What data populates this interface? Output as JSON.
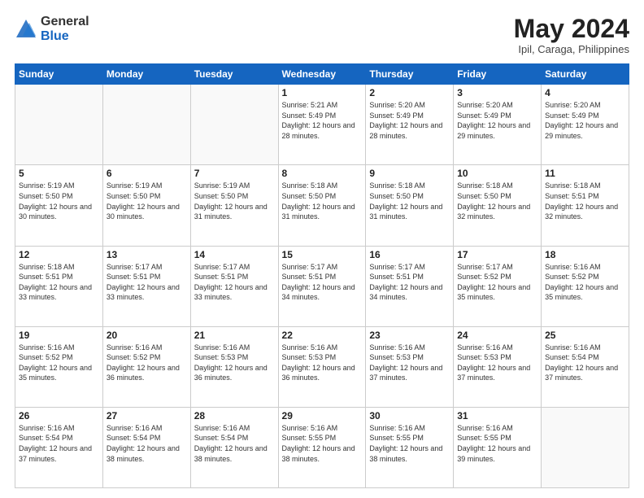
{
  "header": {
    "logo_general": "General",
    "logo_blue": "Blue",
    "month": "May 2024",
    "location": "Ipil, Caraga, Philippines"
  },
  "days_of_week": [
    "Sunday",
    "Monday",
    "Tuesday",
    "Wednesday",
    "Thursday",
    "Friday",
    "Saturday"
  ],
  "weeks": [
    [
      {
        "day": "",
        "sunrise": "",
        "sunset": "",
        "daylight": ""
      },
      {
        "day": "",
        "sunrise": "",
        "sunset": "",
        "daylight": ""
      },
      {
        "day": "",
        "sunrise": "",
        "sunset": "",
        "daylight": ""
      },
      {
        "day": "1",
        "sunrise": "Sunrise: 5:21 AM",
        "sunset": "Sunset: 5:49 PM",
        "daylight": "Daylight: 12 hours and 28 minutes."
      },
      {
        "day": "2",
        "sunrise": "Sunrise: 5:20 AM",
        "sunset": "Sunset: 5:49 PM",
        "daylight": "Daylight: 12 hours and 28 minutes."
      },
      {
        "day": "3",
        "sunrise": "Sunrise: 5:20 AM",
        "sunset": "Sunset: 5:49 PM",
        "daylight": "Daylight: 12 hours and 29 minutes."
      },
      {
        "day": "4",
        "sunrise": "Sunrise: 5:20 AM",
        "sunset": "Sunset: 5:49 PM",
        "daylight": "Daylight: 12 hours and 29 minutes."
      }
    ],
    [
      {
        "day": "5",
        "sunrise": "Sunrise: 5:19 AM",
        "sunset": "Sunset: 5:50 PM",
        "daylight": "Daylight: 12 hours and 30 minutes."
      },
      {
        "day": "6",
        "sunrise": "Sunrise: 5:19 AM",
        "sunset": "Sunset: 5:50 PM",
        "daylight": "Daylight: 12 hours and 30 minutes."
      },
      {
        "day": "7",
        "sunrise": "Sunrise: 5:19 AM",
        "sunset": "Sunset: 5:50 PM",
        "daylight": "Daylight: 12 hours and 31 minutes."
      },
      {
        "day": "8",
        "sunrise": "Sunrise: 5:18 AM",
        "sunset": "Sunset: 5:50 PM",
        "daylight": "Daylight: 12 hours and 31 minutes."
      },
      {
        "day": "9",
        "sunrise": "Sunrise: 5:18 AM",
        "sunset": "Sunset: 5:50 PM",
        "daylight": "Daylight: 12 hours and 31 minutes."
      },
      {
        "day": "10",
        "sunrise": "Sunrise: 5:18 AM",
        "sunset": "Sunset: 5:50 PM",
        "daylight": "Daylight: 12 hours and 32 minutes."
      },
      {
        "day": "11",
        "sunrise": "Sunrise: 5:18 AM",
        "sunset": "Sunset: 5:51 PM",
        "daylight": "Daylight: 12 hours and 32 minutes."
      }
    ],
    [
      {
        "day": "12",
        "sunrise": "Sunrise: 5:18 AM",
        "sunset": "Sunset: 5:51 PM",
        "daylight": "Daylight: 12 hours and 33 minutes."
      },
      {
        "day": "13",
        "sunrise": "Sunrise: 5:17 AM",
        "sunset": "Sunset: 5:51 PM",
        "daylight": "Daylight: 12 hours and 33 minutes."
      },
      {
        "day": "14",
        "sunrise": "Sunrise: 5:17 AM",
        "sunset": "Sunset: 5:51 PM",
        "daylight": "Daylight: 12 hours and 33 minutes."
      },
      {
        "day": "15",
        "sunrise": "Sunrise: 5:17 AM",
        "sunset": "Sunset: 5:51 PM",
        "daylight": "Daylight: 12 hours and 34 minutes."
      },
      {
        "day": "16",
        "sunrise": "Sunrise: 5:17 AM",
        "sunset": "Sunset: 5:51 PM",
        "daylight": "Daylight: 12 hours and 34 minutes."
      },
      {
        "day": "17",
        "sunrise": "Sunrise: 5:17 AM",
        "sunset": "Sunset: 5:52 PM",
        "daylight": "Daylight: 12 hours and 35 minutes."
      },
      {
        "day": "18",
        "sunrise": "Sunrise: 5:16 AM",
        "sunset": "Sunset: 5:52 PM",
        "daylight": "Daylight: 12 hours and 35 minutes."
      }
    ],
    [
      {
        "day": "19",
        "sunrise": "Sunrise: 5:16 AM",
        "sunset": "Sunset: 5:52 PM",
        "daylight": "Daylight: 12 hours and 35 minutes."
      },
      {
        "day": "20",
        "sunrise": "Sunrise: 5:16 AM",
        "sunset": "Sunset: 5:52 PM",
        "daylight": "Daylight: 12 hours and 36 minutes."
      },
      {
        "day": "21",
        "sunrise": "Sunrise: 5:16 AM",
        "sunset": "Sunset: 5:53 PM",
        "daylight": "Daylight: 12 hours and 36 minutes."
      },
      {
        "day": "22",
        "sunrise": "Sunrise: 5:16 AM",
        "sunset": "Sunset: 5:53 PM",
        "daylight": "Daylight: 12 hours and 36 minutes."
      },
      {
        "day": "23",
        "sunrise": "Sunrise: 5:16 AM",
        "sunset": "Sunset: 5:53 PM",
        "daylight": "Daylight: 12 hours and 37 minutes."
      },
      {
        "day": "24",
        "sunrise": "Sunrise: 5:16 AM",
        "sunset": "Sunset: 5:53 PM",
        "daylight": "Daylight: 12 hours and 37 minutes."
      },
      {
        "day": "25",
        "sunrise": "Sunrise: 5:16 AM",
        "sunset": "Sunset: 5:54 PM",
        "daylight": "Daylight: 12 hours and 37 minutes."
      }
    ],
    [
      {
        "day": "26",
        "sunrise": "Sunrise: 5:16 AM",
        "sunset": "Sunset: 5:54 PM",
        "daylight": "Daylight: 12 hours and 37 minutes."
      },
      {
        "day": "27",
        "sunrise": "Sunrise: 5:16 AM",
        "sunset": "Sunset: 5:54 PM",
        "daylight": "Daylight: 12 hours and 38 minutes."
      },
      {
        "day": "28",
        "sunrise": "Sunrise: 5:16 AM",
        "sunset": "Sunset: 5:54 PM",
        "daylight": "Daylight: 12 hours and 38 minutes."
      },
      {
        "day": "29",
        "sunrise": "Sunrise: 5:16 AM",
        "sunset": "Sunset: 5:55 PM",
        "daylight": "Daylight: 12 hours and 38 minutes."
      },
      {
        "day": "30",
        "sunrise": "Sunrise: 5:16 AM",
        "sunset": "Sunset: 5:55 PM",
        "daylight": "Daylight: 12 hours and 38 minutes."
      },
      {
        "day": "31",
        "sunrise": "Sunrise: 5:16 AM",
        "sunset": "Sunset: 5:55 PM",
        "daylight": "Daylight: 12 hours and 39 minutes."
      },
      {
        "day": "",
        "sunrise": "",
        "sunset": "",
        "daylight": ""
      }
    ]
  ]
}
